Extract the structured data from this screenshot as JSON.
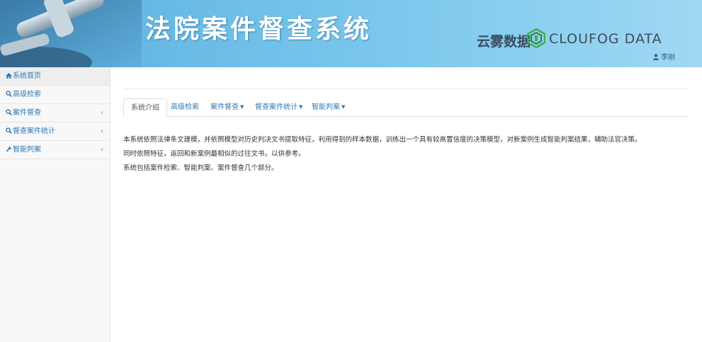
{
  "header": {
    "title": "法院案件督查系统",
    "brand_cn": "云雾数据",
    "brand_en": "CLOUFOG DATA",
    "user_name": "李刚"
  },
  "sidebar": {
    "items": [
      {
        "label": "系统首页",
        "icon": "home-icon",
        "active": true
      },
      {
        "label": "高级检索",
        "icon": "search-icon"
      },
      {
        "label": "案件督查",
        "icon": "search-icon",
        "caret": "‹"
      },
      {
        "label": "督查案件统计",
        "icon": "search-icon",
        "caret": "‹"
      },
      {
        "label": "智能判案",
        "icon": "wrench-icon",
        "caret": "‹"
      }
    ]
  },
  "tabs": [
    {
      "label": "系统介绍",
      "active": true
    },
    {
      "label": "高级检索"
    },
    {
      "label": "案件督查",
      "dropdown": true
    },
    {
      "label": "督查案件统计",
      "dropdown": true
    },
    {
      "label": "智能判案",
      "dropdown": true
    }
  ],
  "content": {
    "lines": [
      "本系统依照法律条文建模，并依照模型对历史判决文书提取特征，利用得到的样本数据，训练出一个具有较高置信度的决策模型，对新案例生成智能判案结果，辅助法官决策。",
      "同时依照特征，返回和新案例最相似的过往文书，以供参考。",
      "系统包括案件检索、智能判案、案件督查几个部分。"
    ]
  },
  "colors": {
    "link": "#337ab7",
    "banner": "#6fbfe8"
  }
}
